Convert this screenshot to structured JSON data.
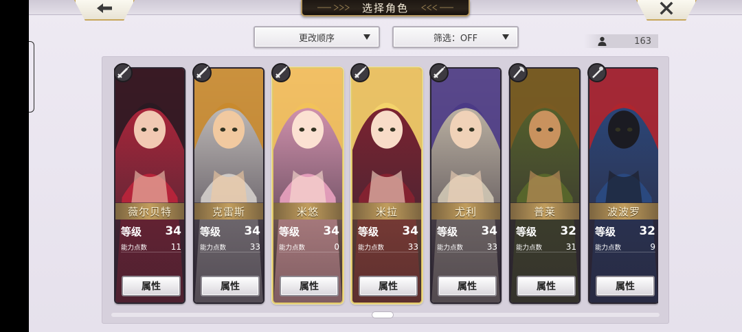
{
  "header": {
    "title": "选择角色",
    "back_icon": "left-arrow-icon",
    "close_icon": "close-icon"
  },
  "controls": {
    "sort_label": "更改顺序",
    "filter_label": "筛选：OFF",
    "unit_count": "163"
  },
  "labels": {
    "level": "等级",
    "ability_points": "能力点数",
    "attributes_button": "属性"
  },
  "characters": [
    {
      "name": "薇尔贝特",
      "level": "34",
      "points": "11",
      "selected": false,
      "weapon": "sword-icon",
      "palette": [
        "#2a1a22",
        "#c1253b",
        "#f1c9b3"
      ]
    },
    {
      "name": "克雷斯",
      "level": "34",
      "points": "33",
      "selected": false,
      "weapon": "sword-icon",
      "palette": [
        "#c98a2e",
        "#d9d5d0",
        "#f1c9a0"
      ]
    },
    {
      "name": "米悠",
      "level": "34",
      "points": "0",
      "selected": true,
      "weapon": "sword-icon",
      "palette": [
        "#f2c25a",
        "#f0a6c4",
        "#fbe1d2"
      ]
    },
    {
      "name": "米拉",
      "level": "34",
      "points": "33",
      "selected": true,
      "weapon": "sword-icon",
      "palette": [
        "#f4d36b",
        "#8b2230",
        "#f8dcc8"
      ]
    },
    {
      "name": "尤利",
      "level": "34",
      "points": "33",
      "selected": false,
      "weapon": "sword-icon",
      "palette": [
        "#4b3a86",
        "#d6ccb8",
        "#f0d2b8"
      ]
    },
    {
      "name": "普莱",
      "level": "32",
      "points": "31",
      "selected": false,
      "weapon": "axe-icon",
      "palette": [
        "#7a5a22",
        "#5b6b2a",
        "#c9925e"
      ]
    },
    {
      "name": "波波罗",
      "level": "32",
      "points": "9",
      "selected": false,
      "weapon": "staff-icon",
      "palette": [
        "#b0252d",
        "#2a4c86",
        "#1b1b22"
      ]
    }
  ]
}
